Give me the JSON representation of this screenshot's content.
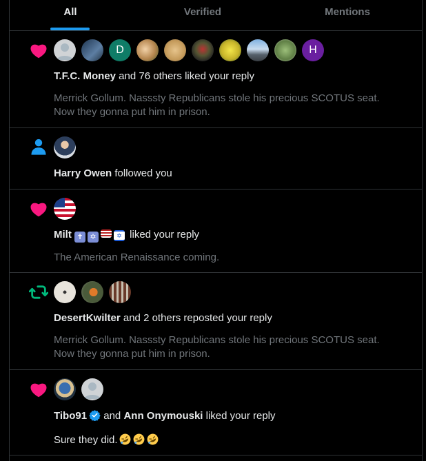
{
  "tabs": [
    {
      "label": "All",
      "active": true
    },
    {
      "label": "Verified",
      "active": false
    },
    {
      "label": "Mentions",
      "active": false
    }
  ],
  "colors": {
    "background": "#000000",
    "text": "#e7e9ea",
    "muted": "#71767b",
    "accent": "#1d9bf0",
    "like": "#f91880",
    "repost": "#00ba7c",
    "border": "#2f3336"
  },
  "notifications": [
    {
      "type": "like",
      "icon": "heart-icon",
      "avatars": [
        "default-avatar",
        "photo-avatar",
        "D",
        "photo-avatar",
        "photo-avatar",
        "photo-avatar",
        "photo-avatar",
        "photo-avatar",
        "photo-avatar",
        "H"
      ],
      "actor": "T.F.C. Money",
      "rest": " and 76 others liked your reply",
      "snippet": "Merrick Gollum.  Nasssty Republicans stole his precious SCOTUS seat.  Now they gonna put him in prison."
    },
    {
      "type": "follow",
      "icon": "person-icon",
      "avatars": [
        "photo-avatar"
      ],
      "actor": "Harry Owen",
      "rest": " followed you"
    },
    {
      "type": "like",
      "icon": "heart-icon",
      "avatars": [
        "flag-avatar"
      ],
      "actor": "Milt",
      "badges": [
        "cross-emoji",
        "star-of-david-emoji",
        "us-flag-emoji",
        "israel-flag-emoji"
      ],
      "rest": " liked your reply",
      "snippet": "The American Renaissance coming."
    },
    {
      "type": "repost",
      "icon": "repost-icon",
      "avatars": [
        "photo-avatar",
        "photo-avatar",
        "photo-avatar"
      ],
      "actor": "DesertKwilter",
      "rest": " and 2 others reposted your reply",
      "snippet": "Merrick Gollum.  Nasssty Republicans stole his precious SCOTUS seat.  Now they gonna put him in prison."
    },
    {
      "type": "like",
      "icon": "heart-icon",
      "avatars": [
        "photo-avatar",
        "default-avatar"
      ],
      "actor": "Tibo91",
      "actor_verified": true,
      "middle": " and ",
      "actor2": "Ann Onymouski",
      "rest": " liked your reply",
      "snippet": "Sure they did.",
      "emojis": [
        "rofl-emoji",
        "rofl-emoji",
        "rofl-emoji"
      ]
    }
  ]
}
